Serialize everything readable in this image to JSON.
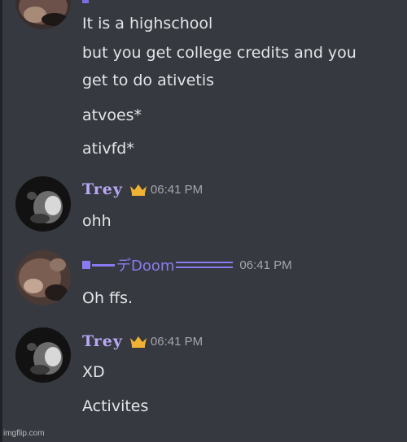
{
  "colors": {
    "background": "#36393f",
    "text": "#e3e5e8",
    "timestamp": "#a3a6aa",
    "trey_name": "#b9a8f6",
    "doom_name": "#8b7bf2",
    "crown": "#f0b232"
  },
  "groups": [
    {
      "author": "",
      "timestamp": "",
      "lines": [
        "It is a highschool",
        "but you get college credits and you",
        "get to do ativetis",
        "atvoes*",
        "ativfd*"
      ]
    },
    {
      "author": "Trey",
      "badge_icon": "crown-icon",
      "timestamp": "06:41 PM",
      "lines": [
        "ohh"
      ]
    },
    {
      "author": "デDoom",
      "timestamp": "06:41 PM",
      "lines": [
        "Oh ffs."
      ]
    },
    {
      "author": "Trey",
      "badge_icon": "crown-icon",
      "timestamp": "06:41 PM",
      "lines": [
        "XD",
        "Activites"
      ]
    }
  ],
  "watermark": "imgflip.com"
}
